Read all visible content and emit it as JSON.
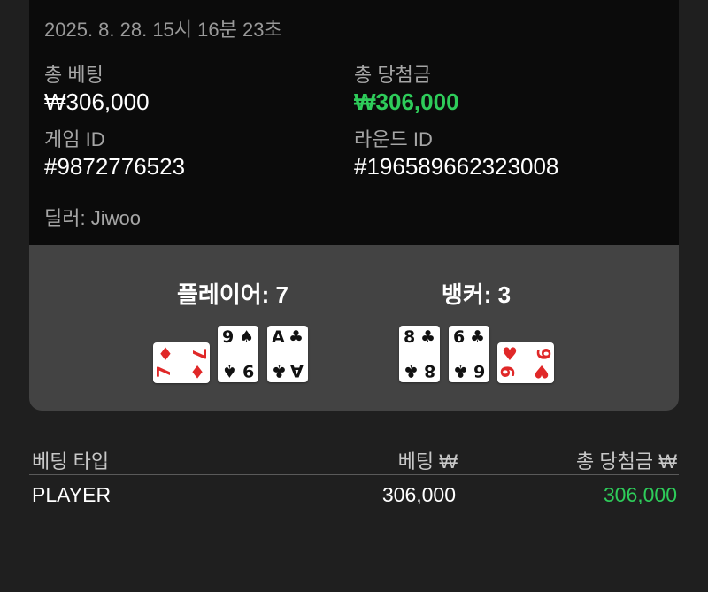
{
  "summary": {
    "timestamp": "2025. 8. 28. 15시 16분 23초",
    "total_bet_label": "총 베팅",
    "total_bet_value": "₩306,000",
    "total_win_label": "총 당첨금",
    "total_win_value": "₩306,000",
    "game_id_label": "게임 ID",
    "game_id_value": "#9872776523",
    "round_id_label": "라운드 ID",
    "round_id_value": "#196589662323008",
    "dealer": "딜러: Jiwoo"
  },
  "player_hand": {
    "title": "플레이어: 7",
    "cards": [
      {
        "rank": "7",
        "suit": "♦",
        "color": "#e02828",
        "orientation": "landscape"
      },
      {
        "rank": "9",
        "suit": "♠",
        "color": "#111111",
        "orientation": "portrait"
      },
      {
        "rank": "A",
        "suit": "♣",
        "color": "#111111",
        "orientation": "portrait"
      }
    ]
  },
  "banker_hand": {
    "title": "뱅커: 3",
    "cards": [
      {
        "rank": "8",
        "suit": "♣",
        "color": "#111111",
        "orientation": "portrait"
      },
      {
        "rank": "6",
        "suit": "♣",
        "color": "#111111",
        "orientation": "portrait"
      },
      {
        "rank": "9",
        "suit": "♥",
        "color": "#e02828",
        "orientation": "landscape"
      }
    ]
  },
  "bet_table": {
    "headers": [
      "베팅 타입",
      "베팅 ₩",
      "총 당첨금 ₩"
    ],
    "rows": [
      {
        "type": "PLAYER",
        "bet": "306,000",
        "win": "306,000"
      }
    ]
  },
  "colors": {
    "win_green": "#2ecc5a",
    "card_red": "#e02828",
    "panel_gray": "#434343",
    "background": "#1f1f1f"
  }
}
